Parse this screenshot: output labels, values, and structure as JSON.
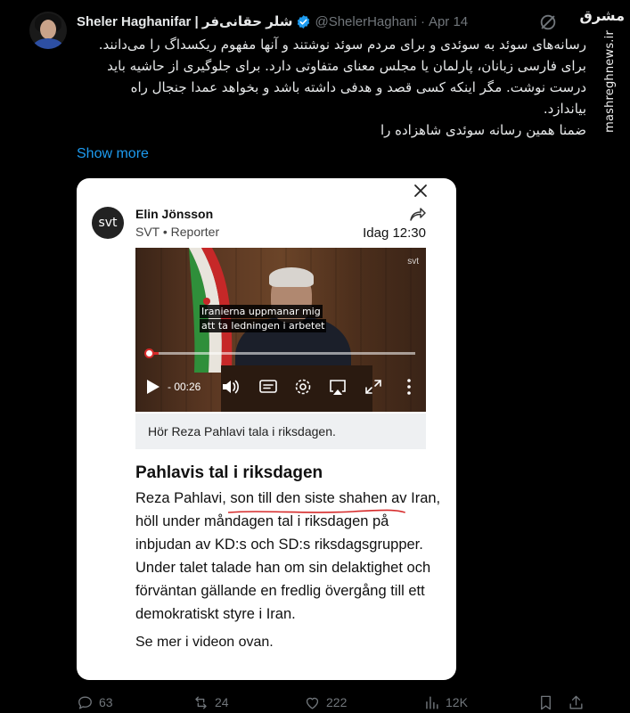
{
  "tweet": {
    "author_name": "Sheler Haghanifar | شلر حقانی‌فر",
    "handle": "@ShelerHaghani",
    "separator": "·",
    "date": "Apr 14",
    "text_lines": [
      "رسانه‌های سوئد به سوئدی و برای مردم سوئد نوشتند و آنها مفهوم ریکسداگ را می‌دانند.",
      "برای فارسی زبانان، پارلمان یا مجلس معنای متفاوتی دارد. برای جلوگیری از حاشیه باید",
      "درست نوشت. مگر اینکه کسی قصد و هدفی داشته باشد و بخواهد عمدا جنجال راه",
      "بیاندازد.",
      "ضمنا همین رسانه سوئدی شاهزاده را"
    ],
    "show_more": "Show more"
  },
  "watermark": {
    "logo": "مشرق",
    "url": "mashreghnews.ir"
  },
  "card": {
    "logo_text": "svt",
    "author": "Elin Jönsson",
    "role": "SVT • Reporter",
    "time": "Idag 12:30",
    "video": {
      "subtitle_lines": [
        "Iranierna uppmanar mig",
        "att ta ledningen i arbetet"
      ],
      "remaining_time": "- 00:26",
      "progress_fraction": 0.04,
      "brand_mark": "svt"
    },
    "caption": "Hör Reza Pahlavi tala i riksdagen.",
    "article_title": "Pahlavis tal i riksdagen",
    "article_body_pre": "Reza Pahlavi,",
    "article_body_underlined": " son till den siste shahen av",
    "article_body_post": " Iran, höll under måndagen tal i riksdagen på inbjudan av KD:s och SD:s riksdagsgrupper. Under talet talade han om sin delaktighet och förväntan gällande en fredlig övergång till ett demokratiskt styre i Iran.",
    "article_more": "Se mer i videon ovan."
  },
  "actions": {
    "replies": "63",
    "reposts": "24",
    "likes": "222",
    "views": "12K"
  },
  "colors": {
    "background": "#000000",
    "link": "#1d9bf0",
    "muted": "#71767b",
    "verified": "#1d9bf0",
    "underline": "#d62b2b"
  },
  "icons": [
    "grok-icon",
    "verified-badge-icon",
    "close-icon",
    "share-icon",
    "play-icon",
    "volume-icon",
    "subtitles-icon",
    "settings-icon",
    "airplay-icon",
    "fullscreen-icon",
    "more-vertical-icon",
    "reply-icon",
    "repost-icon",
    "like-icon",
    "views-icon",
    "bookmark-icon",
    "share-tweet-icon"
  ]
}
